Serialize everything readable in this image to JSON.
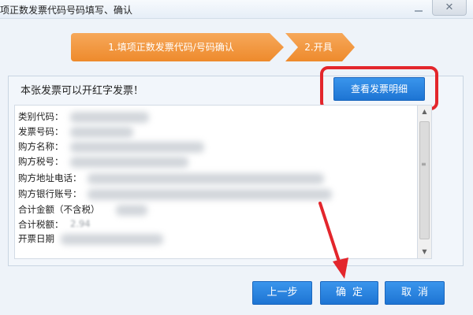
{
  "window": {
    "title": "项正数发票代码号码填写、确认"
  },
  "steps": {
    "step1_label": "1.填项正数发票代码/号码确认",
    "step2_label": "2.开具"
  },
  "notice": "本张发票可以开红字发票！",
  "view_button_label": "查看发票明细",
  "fields": [
    {
      "label": "类别代码："
    },
    {
      "label": "发票号码："
    },
    {
      "label": "购方名称："
    },
    {
      "label": "购方税号："
    },
    {
      "label": "购方地址电话："
    },
    {
      "label": "购方银行账号："
    },
    {
      "label": "合计金额（不含税）"
    },
    {
      "label": "合计税额：",
      "value": "2.94"
    },
    {
      "label": "开票日期"
    }
  ],
  "buttons": {
    "prev": "上一步",
    "ok": "确定",
    "cancel": "取消"
  },
  "colors": {
    "step_orange": "#ee8a2c",
    "button_blue": "#1d74d3",
    "highlight_red": "#e3262c"
  }
}
